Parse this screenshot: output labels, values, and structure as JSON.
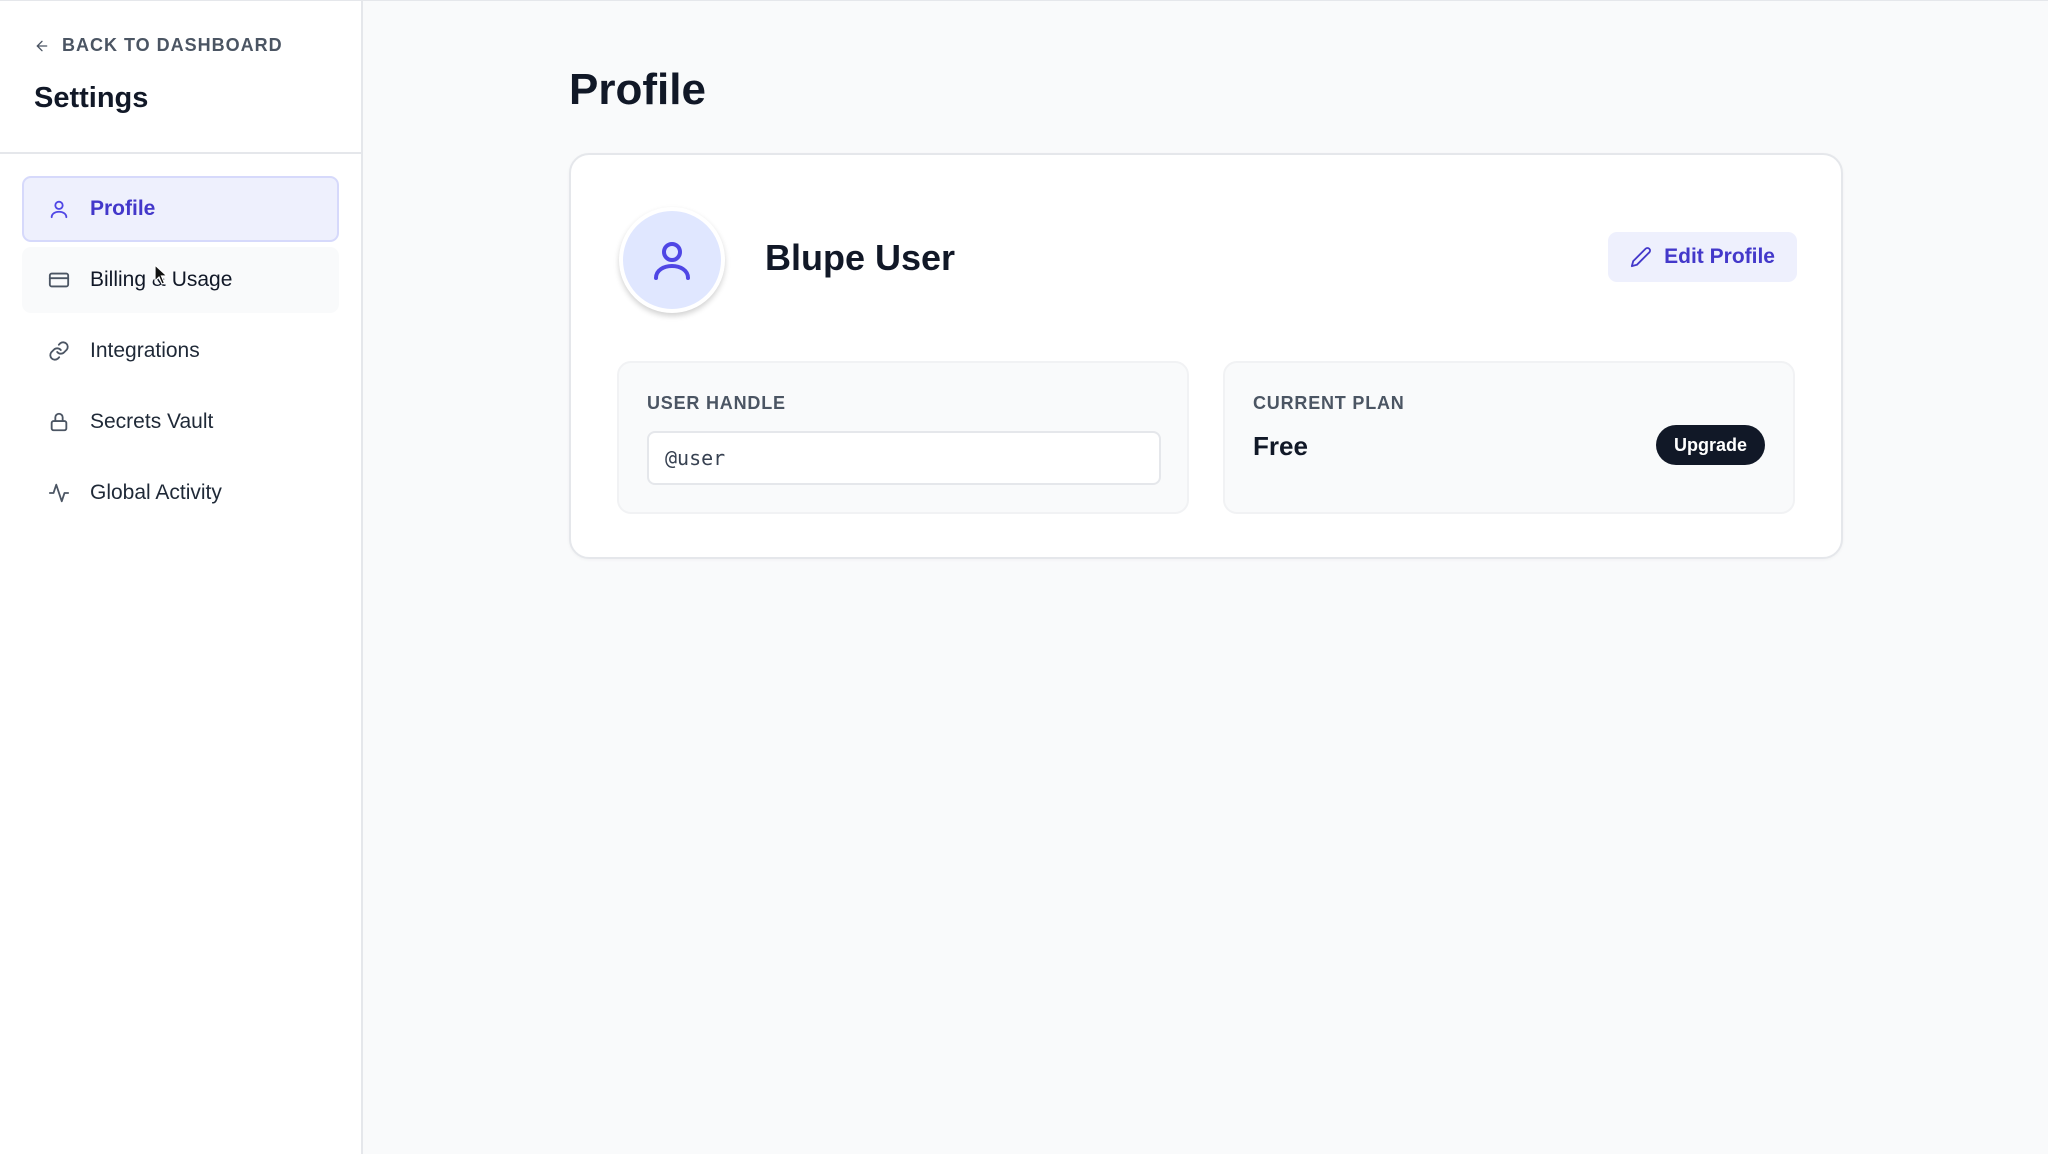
{
  "sidebar": {
    "back_label": "BACK TO DASHBOARD",
    "title": "Settings",
    "items": [
      {
        "label": "Profile",
        "icon": "user-icon",
        "state": "active"
      },
      {
        "label": "Billing & Usage",
        "icon": "credit-card-icon",
        "state": "hover"
      },
      {
        "label": "Integrations",
        "icon": "link-icon",
        "state": ""
      },
      {
        "label": "Secrets Vault",
        "icon": "lock-icon",
        "state": ""
      },
      {
        "label": "Global Activity",
        "icon": "activity-icon",
        "state": ""
      }
    ]
  },
  "main": {
    "page_title": "Profile",
    "profile": {
      "name": "Blupe User",
      "edit_label": "Edit Profile"
    },
    "handle": {
      "label": "USER HANDLE",
      "value": "@user"
    },
    "plan": {
      "label": "CURRENT PLAN",
      "value": "Free",
      "upgrade_label": "Upgrade"
    }
  },
  "colors": {
    "accent": "#4f46e5",
    "accent_bg": "#eef0fd",
    "dark": "#111827"
  }
}
